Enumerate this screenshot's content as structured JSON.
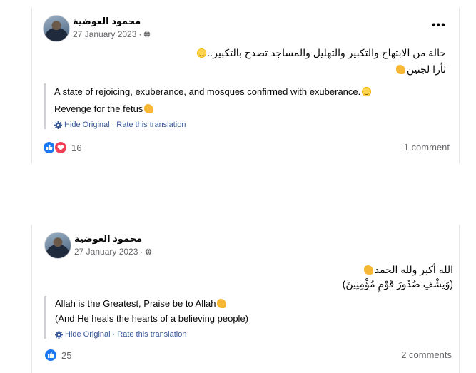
{
  "posts": [
    {
      "author": "محمود العوضية",
      "date": "27 January 2023",
      "dot": "·",
      "original_lines": [
        "حالة من الابتهاج والتكبير والتهليل والمساجد تصدح بالتكبير..",
        "ثأرا لجنين"
      ],
      "translation_lines": [
        "A state of rejoicing, exuberance, and mosques confirmed with exuberance.",
        "Revenge for the fetus"
      ],
      "hide_original": "Hide Original",
      "link_sep": "·",
      "rate_translation": "Rate this translation",
      "reaction_count": "16",
      "comments": "1 comment",
      "reaction_icons": [
        "like-icon",
        "love-icon"
      ]
    },
    {
      "author": "محمود العوضية",
      "date": "27 January 2023",
      "dot": "·",
      "original_lines": [
        "الله أكبر ولله الحمد",
        "(وَيَشْفِ صُدُورَ قَوْمٍ مُؤْمِنِينَ)"
      ],
      "translation_lines": [
        "Allah is the Greatest, Praise be to Allah",
        "(And He heals the hearts of a believing people)"
      ],
      "hide_original": "Hide Original",
      "link_sep": "·",
      "rate_translation": "Rate this translation",
      "reaction_count": "25",
      "comments": "2 comments",
      "reaction_icons": [
        "like-icon"
      ]
    }
  ],
  "colors": {
    "link": "#385898",
    "like": "#1877f2",
    "love": "#f33e58",
    "muted": "#65676b"
  }
}
